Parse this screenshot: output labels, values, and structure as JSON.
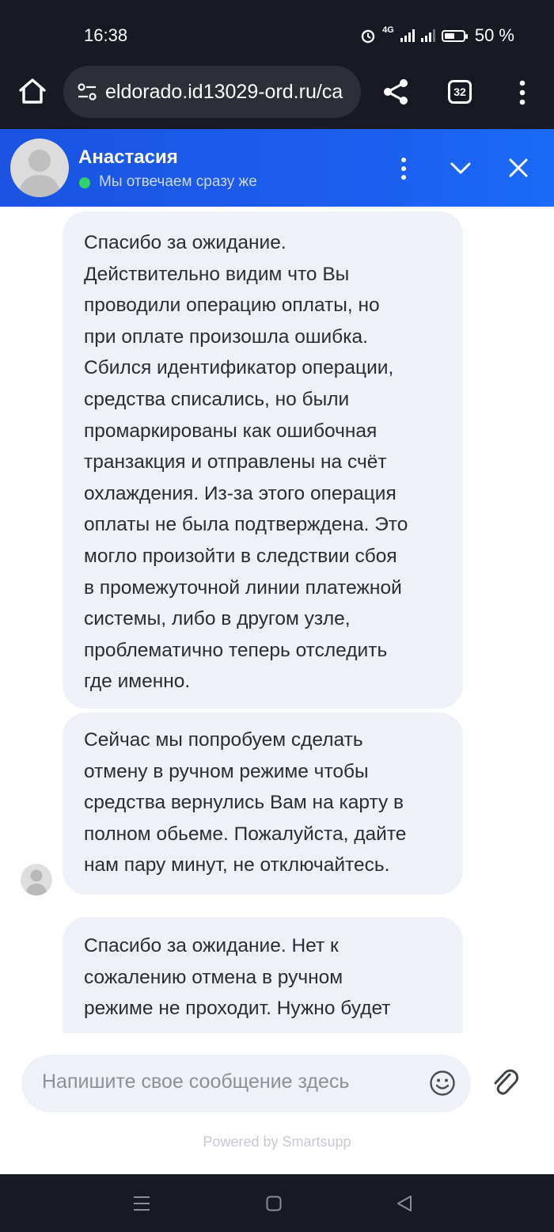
{
  "status_bar": {
    "time": "16:38",
    "battery": "50 %",
    "network": "4G"
  },
  "browser": {
    "url": "eldorado.id13029-ord.ru/ca",
    "tab_count": "32"
  },
  "chat_header": {
    "agent_name": "Анастасия",
    "agent_status": "Мы отвечаем сразу же"
  },
  "messages": [
    {
      "sender": "agent",
      "text": "Спасибо за ожидание.\nДействительно видим что Вы\nпроводили операцию оплаты, но\nпри оплате произошла ошибка.\nСбился идентификатор операции,\nсредства списались, но были\nпромаркированы как ошибочная\nтранзакция и отправлены на счёт\nохлаждения. Из-за этого операция\nоплаты не была подтверждена. Это\nмогло произойти в следствии сбоя\nв промежуточной линии платежной\nсистемы, либо в другом узле,\nпроблематично теперь отследить\nгде именно."
    },
    {
      "sender": "agent",
      "text": "Сейчас мы попробуем сделать\nотмену в ручном режиме чтобы\nсредства вернулись Вам на карту в\nполном обьеме. Пожалуйста, дайте\nнам пару минут, не отключайтесь."
    },
    {
      "sender": "agent",
      "text": "Спасибо за ожидание. Нет к\nсожалению отмена в ручном\nрежиме не проходит. Нужно будет"
    }
  ],
  "composer": {
    "placeholder": "Напишите свое сообщение здесь"
  },
  "footer": {
    "powered_by": "Powered by Smartsupp"
  },
  "icons": {
    "home": "home-icon",
    "site_settings": "tune-icon",
    "share": "share-icon",
    "menu": "kebab-icon",
    "minimize": "chevron-down-icon",
    "close": "close-icon",
    "emoji": "smiley-icon",
    "attach": "paperclip-icon"
  },
  "colors": {
    "header_gradient_start": "#1a54e0",
    "header_gradient_end": "#1b6af8",
    "online": "#2fd26b",
    "bubble": "#eef1f7",
    "system_bar": "#171a23"
  }
}
